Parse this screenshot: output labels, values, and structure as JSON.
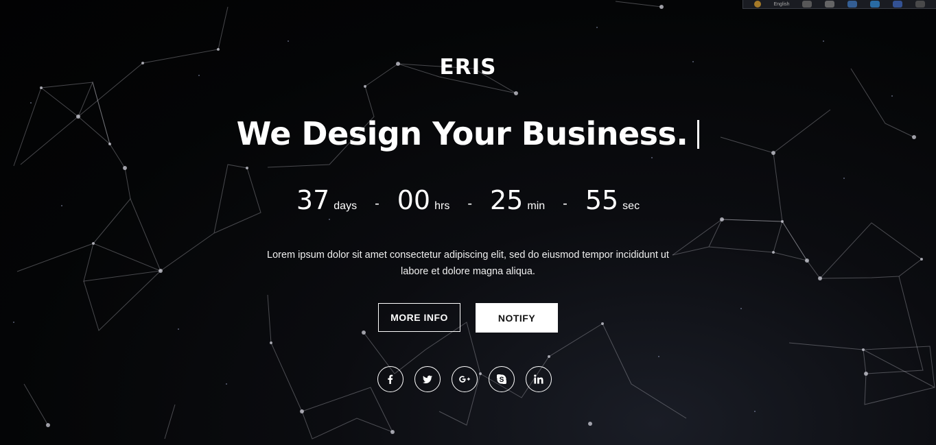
{
  "toolbar": {
    "language": "English"
  },
  "brand": "ERIS",
  "headline": "We Design Your Business.",
  "countdown": {
    "days": {
      "value": "37",
      "label": "days"
    },
    "hours": {
      "value": "00",
      "label": "hrs"
    },
    "minutes": {
      "value": "25",
      "label": "min"
    },
    "seconds": {
      "value": "55",
      "label": "sec"
    },
    "separator": "-"
  },
  "description": "Lorem ipsum dolor sit amet consectetur adipiscing elit, sed do eiusmod tempor incididunt ut labore et dolore magna aliqua.",
  "buttons": {
    "more_info": "MORE INFO",
    "notify": "NOTIFY"
  },
  "social": [
    "facebook-icon",
    "twitter-icon",
    "google-plus-icon",
    "skype-icon",
    "linkedin-icon"
  ]
}
